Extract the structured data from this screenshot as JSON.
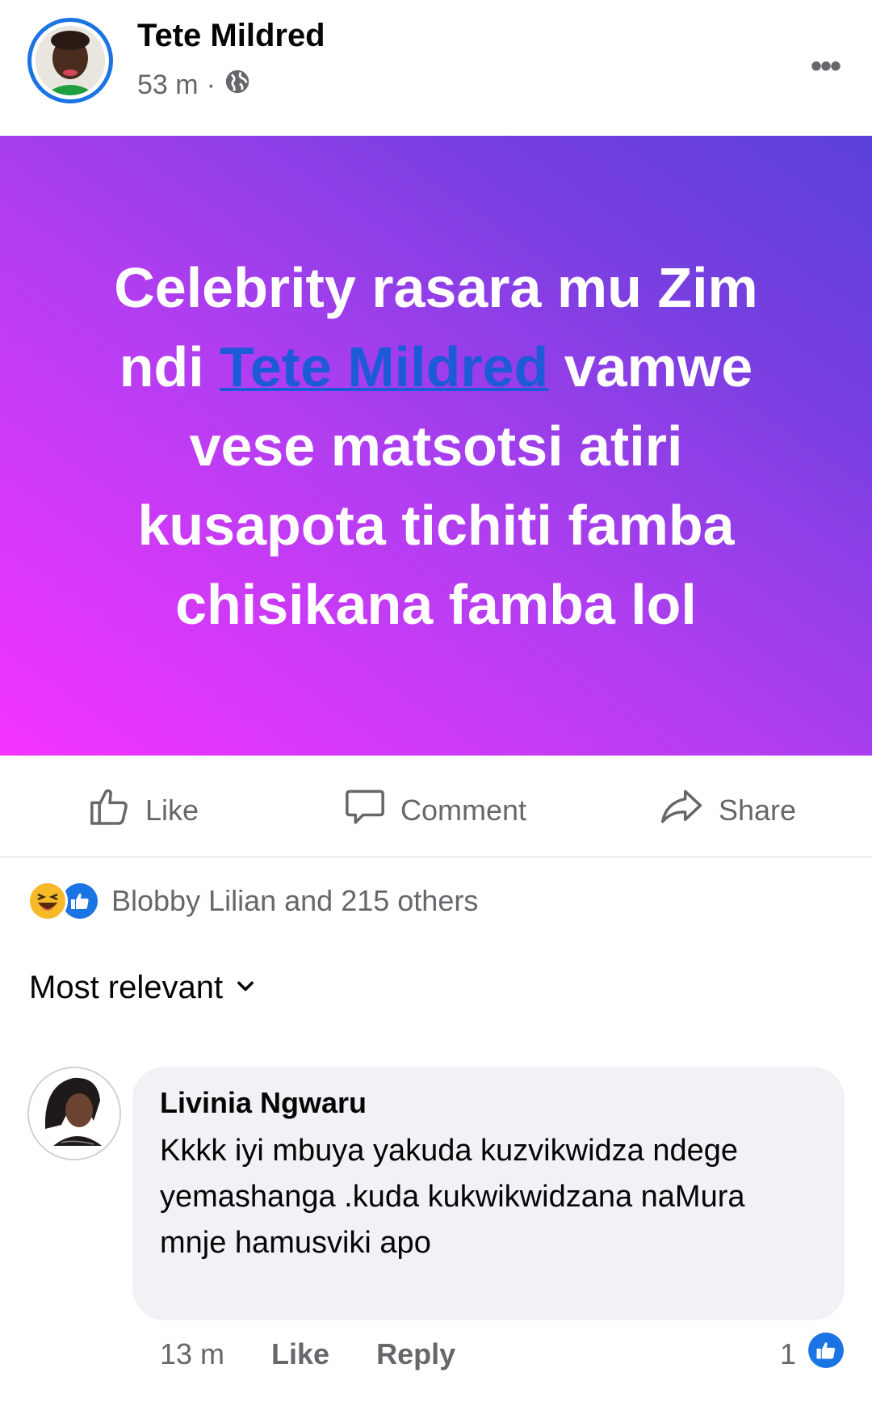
{
  "post": {
    "author": "Tete Mildred",
    "time": "53 m",
    "separator": "·",
    "privacy_icon": "globe-icon",
    "more_label": "•••",
    "text_before": "Celebrity rasara mu Zim ndi ",
    "mention": "Tete Mildred",
    "text_after": " vamwe vese matsotsi atiri kusapota tichiti famba chisikana famba lol",
    "banner_colors": [
      "#f434ff",
      "#5b40d8"
    ]
  },
  "actions": {
    "like": "Like",
    "comment": "Comment",
    "share": "Share"
  },
  "reactions": {
    "summary": "Blobby Lilian and 215 others",
    "icons": [
      "haha-emoji-icon",
      "like-emoji-icon"
    ]
  },
  "comments_sort": {
    "label": "Most relevant"
  },
  "comment": {
    "author": "Livinia Ngwaru",
    "text": "Kkkk iyi mbuya yakuda kuzvikwidza ndege yemashanga .kuda kukwikwidzana naMura mnje hamusviki apo",
    "time": "13 m",
    "like": "Like",
    "reply": "Reply",
    "reaction_count": "1"
  },
  "colors": {
    "accent": "#1b74e4",
    "secondary_text": "#65676b",
    "bubble": "#f0f2f5"
  }
}
